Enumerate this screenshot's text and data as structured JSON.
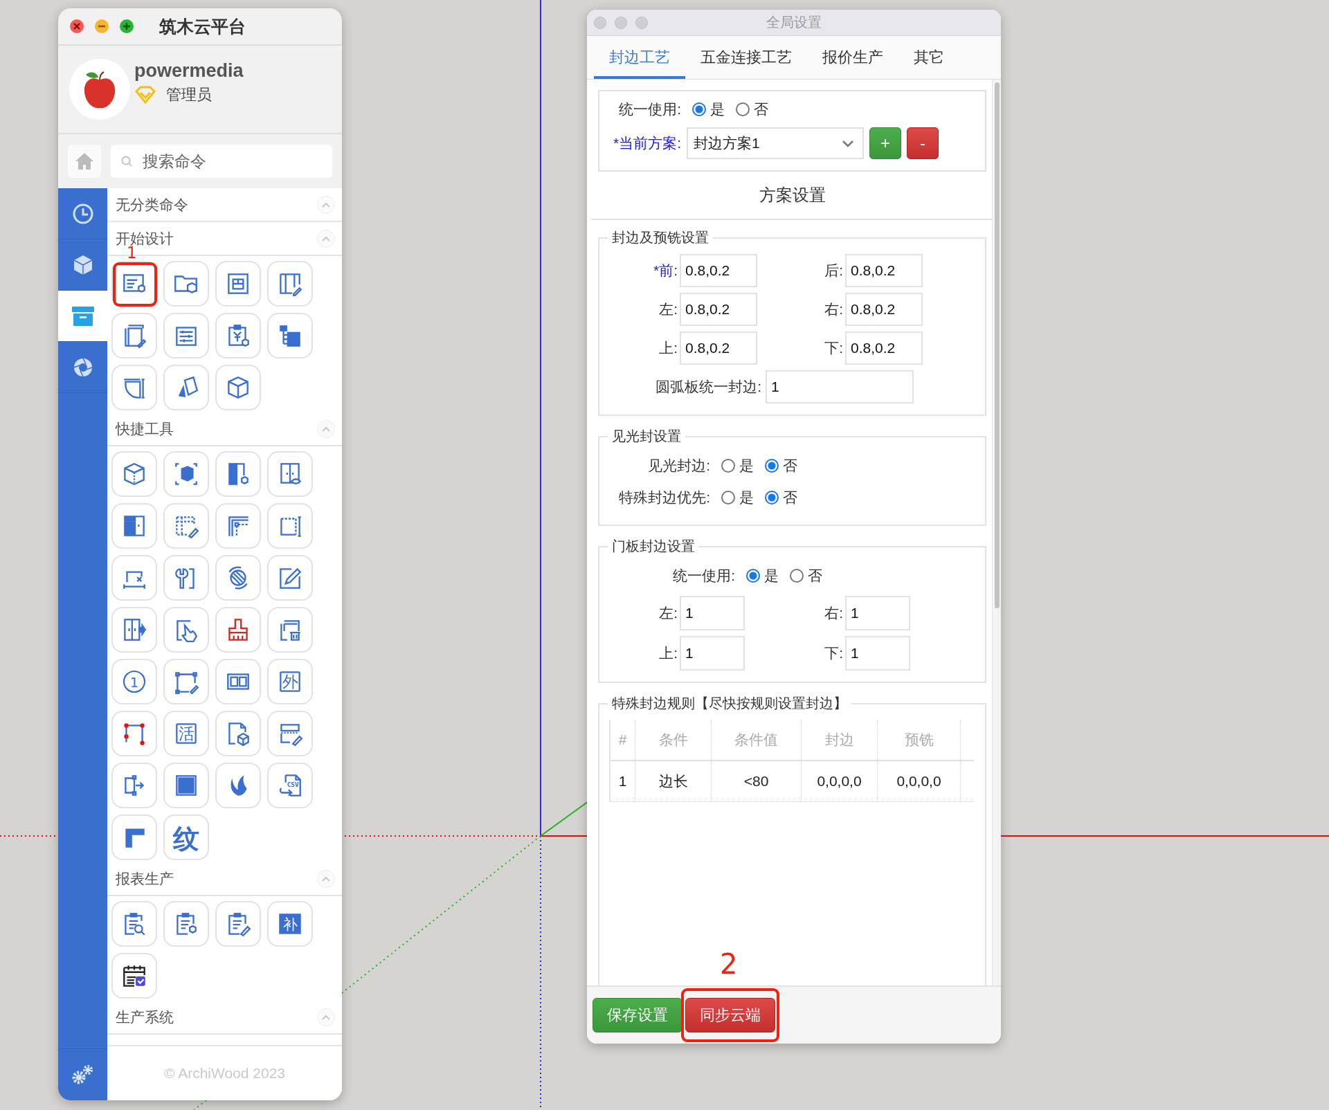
{
  "launcher": {
    "title": "筑木云平台",
    "user": {
      "name": "powermedia",
      "role": "管理员"
    },
    "search": {
      "placeholder": "搜索命令"
    },
    "nav": [
      {
        "kind": "clock",
        "selected": false
      },
      {
        "kind": "cube",
        "selected": false
      },
      {
        "kind": "box",
        "selected": true
      },
      {
        "kind": "aperture",
        "selected": false
      }
    ],
    "sections": [
      {
        "title": "无分类命令"
      },
      {
        "title": "开始设计",
        "tools": [
          {
            "kind": "list-gear",
            "callout": "1"
          },
          {
            "kind": "folder-cube"
          },
          {
            "kind": "panel"
          },
          {
            "kind": "panel-pen"
          },
          {
            "kind": "copy-pen"
          },
          {
            "kind": "sliders"
          },
          {
            "kind": "clip-gear"
          },
          {
            "kind": "tree"
          },
          {
            "kind": "curved"
          },
          {
            "kind": "board"
          },
          {
            "kind": "box"
          }
        ]
      },
      {
        "title": "快捷工具",
        "tools": [
          {
            "kind": "cube-dash"
          },
          {
            "kind": "cube-frame"
          },
          {
            "kind": "door-gear"
          },
          {
            "kind": "door-eye"
          },
          {
            "kind": "cabinet"
          },
          {
            "kind": "dash-pen"
          },
          {
            "kind": "corner"
          },
          {
            "kind": "dash-dim"
          },
          {
            "kind": "desk-x"
          },
          {
            "kind": "wrench"
          },
          {
            "kind": "rotate"
          },
          {
            "kind": "edit"
          },
          {
            "kind": "door-arrow"
          },
          {
            "kind": "hand"
          },
          {
            "kind": "brush"
          },
          {
            "kind": "copy-trash"
          },
          {
            "kind": "glyph-circle",
            "glyph": "1"
          },
          {
            "kind": "rect-pen"
          },
          {
            "kind": "frame"
          },
          {
            "kind": "glyph-box",
            "glyph": "外"
          },
          {
            "kind": "red-corners"
          },
          {
            "kind": "glyph-box",
            "glyph": "活"
          },
          {
            "kind": "doc-cube"
          },
          {
            "kind": "rows-pen"
          },
          {
            "kind": "split"
          },
          {
            "kind": "square"
          },
          {
            "kind": "flame"
          },
          {
            "kind": "csv",
            "glyph": "CSV"
          },
          {
            "kind": "l-shape"
          },
          {
            "kind": "glyph-plain",
            "glyph": "纹"
          }
        ]
      },
      {
        "title": "报表生产",
        "tools": [
          {
            "kind": "doc-search"
          },
          {
            "kind": "doc-gear"
          },
          {
            "kind": "doc-edit"
          },
          {
            "kind": "glyph-fill",
            "glyph": "补"
          },
          {
            "kind": "calendar"
          }
        ]
      },
      {
        "title": "生产系统"
      }
    ],
    "footer": "© ArchiWood 2023"
  },
  "settings": {
    "title": "全局设置",
    "tabs": [
      {
        "label": "封边工艺",
        "selected": true
      },
      {
        "label": "五金连接工艺",
        "selected": false
      },
      {
        "label": "报价生产",
        "selected": false
      },
      {
        "label": "其它",
        "selected": false
      }
    ],
    "unified": {
      "label": "统一使用:",
      "options": [
        {
          "label": "是",
          "selected": true
        },
        {
          "label": "否",
          "selected": false
        }
      ]
    },
    "scheme": {
      "label": "*当前方案:",
      "required": true,
      "value": "封边方案1"
    },
    "scheme_buttons": [
      {
        "kind": "add",
        "label": "+"
      },
      {
        "kind": "remove",
        "label": "-"
      }
    ],
    "heading": "方案设置",
    "groups": [
      {
        "kind": "fields",
        "legend": "封边及预铣设置",
        "fields": [
          {
            "label": "*前:",
            "required": true,
            "value": "0.8,0.2"
          },
          {
            "label": "后:",
            "required": false,
            "value": "0.8,0.2"
          },
          {
            "label": "左:",
            "required": false,
            "value": "0.8,0.2"
          },
          {
            "label": "右:",
            "required": false,
            "value": "0.8,0.2"
          },
          {
            "label": "上:",
            "required": false,
            "value": "0.8,0.2"
          },
          {
            "label": "下:",
            "required": false,
            "value": "0.8,0.2"
          }
        ],
        "wide_field": {
          "label": "圆弧板统一封边:",
          "value": "1"
        }
      },
      {
        "kind": "radios",
        "legend": "见光封设置",
        "rows": [
          {
            "label": "见光封边:",
            "options": [
              {
                "label": "是",
                "selected": false
              },
              {
                "label": "否",
                "selected": true
              }
            ]
          },
          {
            "label": "特殊封边优先:",
            "options": [
              {
                "label": "是",
                "selected": false
              },
              {
                "label": "否",
                "selected": true
              }
            ]
          }
        ]
      },
      {
        "kind": "door",
        "legend": "门板封边设置",
        "rows": [
          {
            "label": "统一使用:",
            "options": [
              {
                "label": "是",
                "selected": true
              },
              {
                "label": "否",
                "selected": false
              }
            ]
          }
        ],
        "fields": [
          {
            "label": "左:",
            "required": false,
            "value": "1"
          },
          {
            "label": "右:",
            "required": false,
            "value": "1"
          },
          {
            "label": "上:",
            "required": false,
            "value": "1"
          },
          {
            "label": "下:",
            "required": false,
            "value": "1"
          }
        ]
      },
      {
        "kind": "table",
        "legend": "特殊封边规则【尽快按规则设置封边】",
        "columns": [
          "#",
          "条件",
          "条件值",
          "封边",
          "预铣"
        ],
        "rows": [
          [
            "1",
            "边长",
            "<80",
            "0,0,0,0",
            "0,0,0,0"
          ]
        ]
      }
    ],
    "buttons": [
      {
        "kind": "save",
        "label": "保存设置"
      },
      {
        "kind": "sync",
        "label": "同步云端",
        "callout": "2"
      }
    ]
  }
}
